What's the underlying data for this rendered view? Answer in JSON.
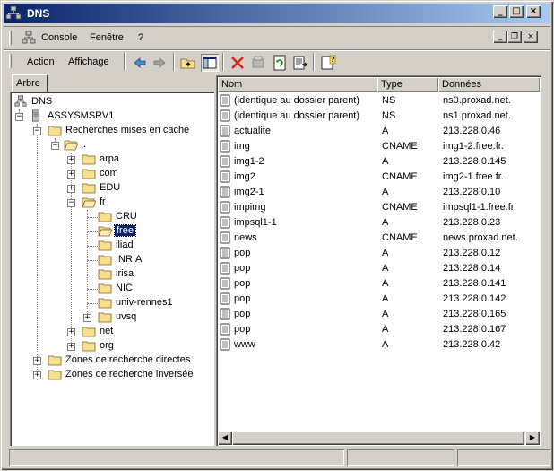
{
  "window": {
    "title": "DNS"
  },
  "menubar": {
    "items": [
      "Console",
      "Fenêtre",
      "?"
    ]
  },
  "toolbar": {
    "action_label": "Action",
    "view_label": "Affichage"
  },
  "tabs": {
    "tree_tab": "Arbre"
  },
  "tree": {
    "root": "DNS",
    "server": "ASSYSMSRV1",
    "cached": "Recherches mises en cache",
    "dot": ".",
    "arpa": "arpa",
    "com": "com",
    "edu": "EDU",
    "fr": "fr",
    "fr_children": [
      "CRU",
      "free",
      "iliad",
      "INRIA",
      "irisa",
      "NIC",
      "univ-rennes1",
      "uvsq"
    ],
    "net": "net",
    "org": "org",
    "forward": "Zones de recherche directes",
    "reverse": "Zones de recherche inversée"
  },
  "list": {
    "columns": [
      "Nom",
      "Type",
      "Données"
    ],
    "rows": [
      [
        "(identique au dossier parent)",
        "NS",
        "ns0.proxad.net."
      ],
      [
        "(identique au dossier parent)",
        "NS",
        "ns1.proxad.net."
      ],
      [
        "actualite",
        "A",
        "213.228.0.46"
      ],
      [
        "img",
        "CNAME",
        "img1-2.free.fr."
      ],
      [
        "img1-2",
        "A",
        "213.228.0.145"
      ],
      [
        "img2",
        "CNAME",
        "img2-1.free.fr."
      ],
      [
        "img2-1",
        "A",
        "213.228.0.10"
      ],
      [
        "impimg",
        "CNAME",
        "impsql1-1.free.fr."
      ],
      [
        "impsql1-1",
        "A",
        "213.228.0.23"
      ],
      [
        "news",
        "CNAME",
        "news.proxad.net."
      ],
      [
        "pop",
        "A",
        "213.228.0.12"
      ],
      [
        "pop",
        "A",
        "213.228.0.14"
      ],
      [
        "pop",
        "A",
        "213.228.0.141"
      ],
      [
        "pop",
        "A",
        "213.228.0.142"
      ],
      [
        "pop",
        "A",
        "213.228.0.165"
      ],
      [
        "pop",
        "A",
        "213.228.0.167"
      ],
      [
        "www",
        "A",
        "213.228.0.42"
      ]
    ]
  },
  "icons": [
    "dns-server-icon",
    "back-arrow-icon",
    "forward-arrow-icon",
    "up-folder-icon",
    "show-tree-icon",
    "delete-icon",
    "properties-icon",
    "refresh-icon",
    "export-list-icon",
    "help-icon",
    "folder-icon",
    "record-icon"
  ],
  "colors": {
    "title_start": "#0a246a",
    "title_end": "#a6caf0",
    "face": "#d4d0c8",
    "selection": "#0a246a",
    "folder": "#f8e08e"
  }
}
